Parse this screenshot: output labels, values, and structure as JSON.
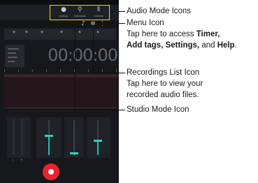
{
  "phone": {
    "modes": [
      {
        "id": "normal",
        "label": "NORMAL",
        "icon": "microphone-icon"
      },
      {
        "id": "interview",
        "label": "INTERVIEW",
        "icon": "interview-icon"
      },
      {
        "id": "custom",
        "label": "CUSTOM",
        "icon": "custom-mixer-icon"
      }
    ],
    "toolbar": {
      "studio_icon": "studio-mode-icon",
      "list_icon": "recordings-list-icon",
      "menu_icon": "menu-icon"
    },
    "timer": "00:00:00",
    "record_button_icon": "record-icon"
  },
  "callouts": {
    "audio_mode": {
      "title": "Audio Mode Icons"
    },
    "menu": {
      "title": "Menu Icon",
      "line1": "Tap here to access ",
      "timer": "Timer,",
      "line2_items": "Add tags, Settings,",
      "line2_and": " and ",
      "help": "Help",
      "period": "."
    },
    "recordings_list": {
      "title": "Recordings List Icon",
      "line1": "Tap here to view your",
      "line2": "recorded audio files."
    },
    "studio": {
      "title": "Studio Mode Icon"
    }
  },
  "colors": {
    "highlight": "#ffd400",
    "accent": "#17c3b2",
    "record": "#e8232c"
  }
}
